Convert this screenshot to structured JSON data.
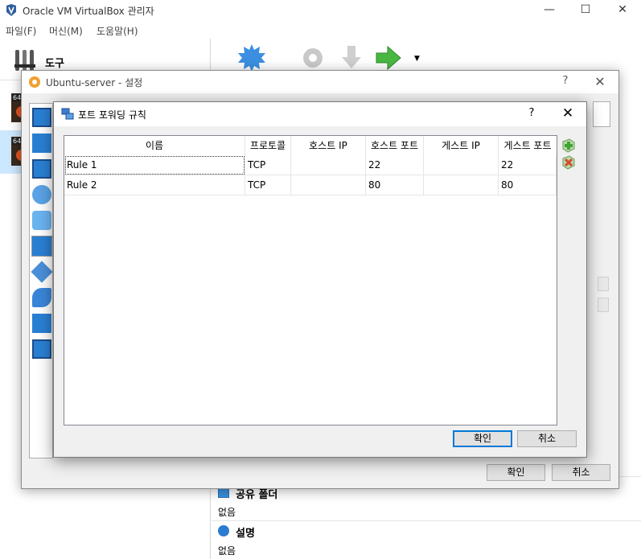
{
  "main_window": {
    "title": "Oracle VM VirtualBox 관리자",
    "controls": {
      "minimize": "—",
      "maximize": "☐",
      "close": "✕"
    },
    "menu": [
      "파일(F)",
      "머신(M)",
      "도움말(H)"
    ],
    "tools_label": "도구",
    "vm_badges": [
      "64",
      "64"
    ],
    "details": {
      "shared_folders_heading": "공유 폴더",
      "shared_folders_value": "없음",
      "description_heading": "설명",
      "description_value": "없음"
    }
  },
  "settings_dialog": {
    "title": "Ubuntu-server - 설정",
    "help": "?",
    "close": "✕",
    "ok_label": "확인",
    "cancel_label": "취소"
  },
  "port_forwarding_dialog": {
    "title": "포트 포워딩 규칙",
    "help": "?",
    "close": "✕",
    "columns": [
      "이름",
      "프로토콜",
      "호스트 IP",
      "호스트 포트",
      "게스트 IP",
      "게스트 포트"
    ],
    "rules": [
      {
        "name": "Rule 1",
        "protocol": "TCP",
        "host_ip": "",
        "host_port": "22",
        "guest_ip": "",
        "guest_port": "22"
      },
      {
        "name": "Rule 2",
        "protocol": "TCP",
        "host_ip": "",
        "host_port": "80",
        "guest_ip": "",
        "guest_port": "80"
      }
    ],
    "add_rule_icon": "add-rule-icon",
    "remove_rule_icon": "remove-rule-icon",
    "ok_label": "확인",
    "cancel_label": "취소"
  },
  "colors": {
    "accent": "#0078d7",
    "add_green": "#3da435",
    "remove_red": "#d64a2f"
  }
}
